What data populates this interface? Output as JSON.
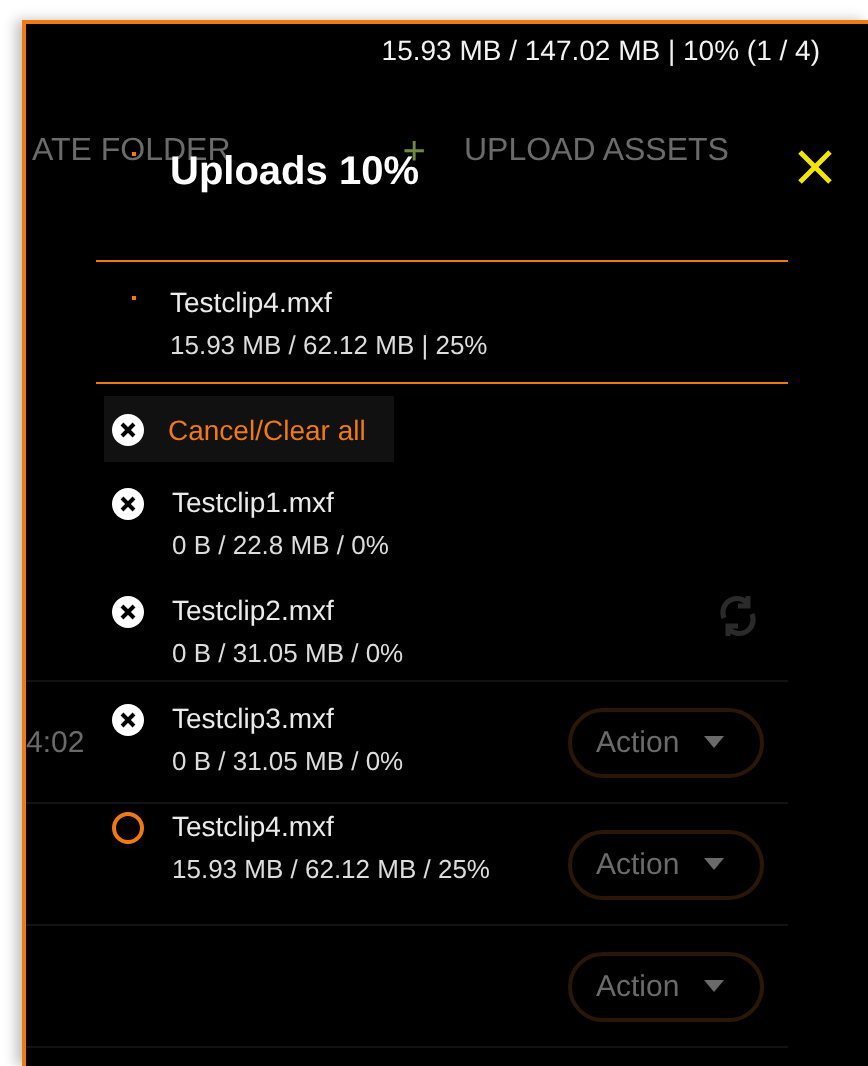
{
  "status_bar": {
    "text": "15.93 MB / 147.02 MB | 10% (1 / 4)"
  },
  "toolbar": {
    "folder_button": "ATE FOLDER",
    "add_glyph": "+",
    "upload_button": "UPLOAD ASSETS"
  },
  "table": {
    "rows": [
      {
        "column_1": "4:02",
        "action": "Action"
      },
      {
        "action": "Action"
      },
      {
        "action": "Action"
      }
    ]
  },
  "uploads_panel": {
    "title": "Uploads 10%",
    "current": {
      "name": "Testclip4.mxf",
      "progress": "15.93 MB / 62.12 MB | 25%"
    },
    "cancel_all": "Cancel/Clear all",
    "items": [
      {
        "kind": "queued",
        "name": "Testclip1.mxf",
        "progress": "0 B / 22.8 MB / 0%"
      },
      {
        "kind": "queued",
        "name": "Testclip2.mxf",
        "progress": "0 B / 31.05 MB / 0%"
      },
      {
        "kind": "queued",
        "name": "Testclip3.mxf",
        "progress": "0 B / 31.05 MB / 0%"
      },
      {
        "kind": "active",
        "name": "Testclip4.mxf",
        "progress": "15.93 MB / 62.12 MB / 25%"
      }
    ]
  }
}
